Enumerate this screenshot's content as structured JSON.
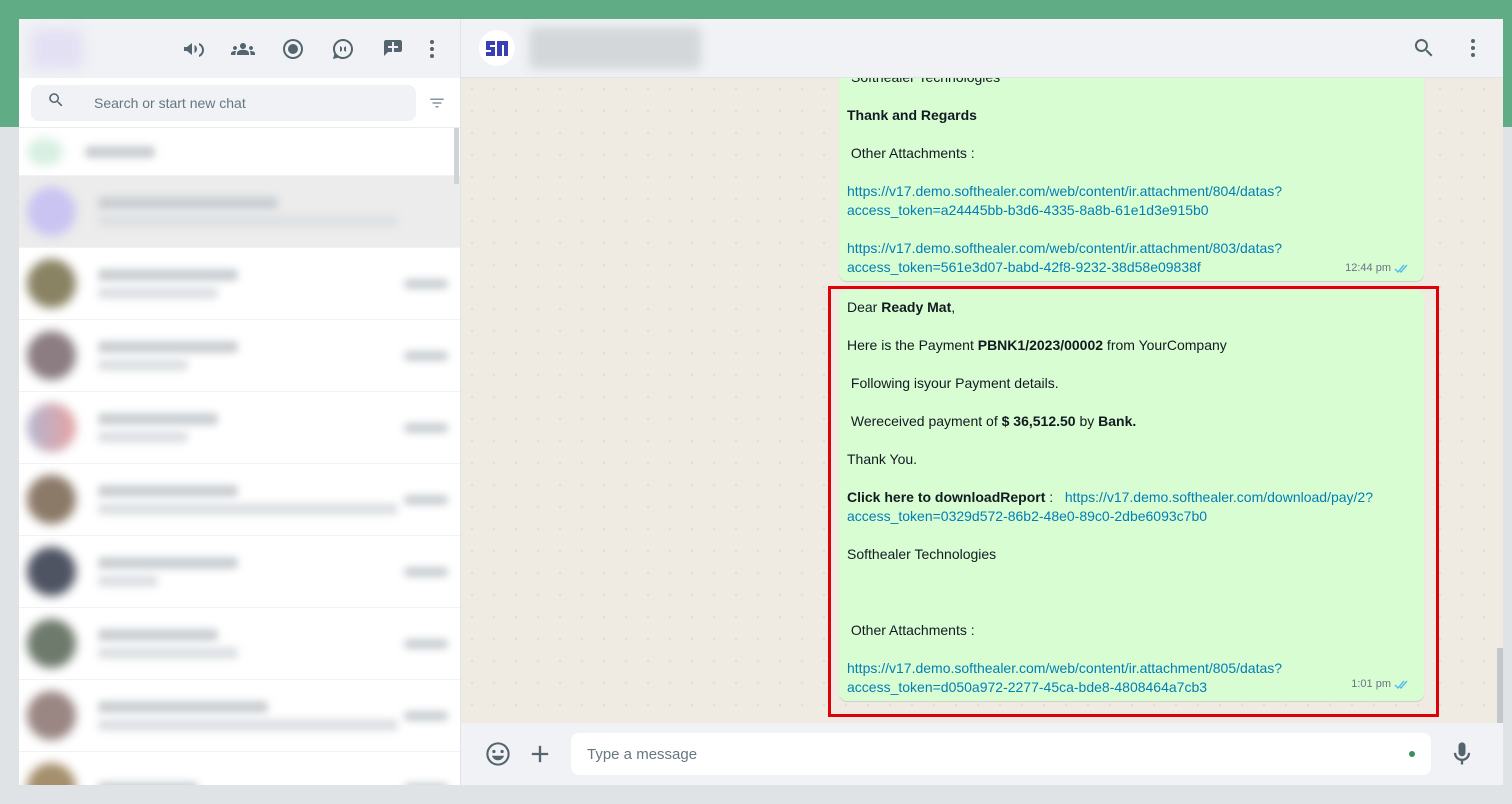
{
  "sidebar": {
    "header_icons": [
      "megaphone-icon",
      "community-icon",
      "status-icon",
      "channels-icon",
      "new-chat-icon",
      "menu-icon"
    ],
    "search": {
      "placeholder": "Search or start new chat"
    }
  },
  "conversation": {
    "message_1": {
      "company_top": "Softhealer Technologies",
      "closing": "Thank and Regards",
      "attachments_label": " Other Attachments :",
      "link_1": "https://v17.demo.softhealer.com/web/content/ir.attachment/804/datas?access_token=a24445bb-b3d6-4335-8a8b-61e1d3e915b0",
      "link_1_line1": "https://v17.demo.softhealer.com/web/content/ir.attachment/804/datas?",
      "link_1_line2": "access_token=a24445bb-b3d6-4335-8a8b-61e1d3e915b0",
      "link_2": "https://v17.demo.softhealer.com/web/content/ir.attachment/803/datas?access_token=561e3d07-babd-42f8-9232-38d58e09838f",
      "link_2_line1": "https://v17.demo.softhealer.com/web/content/ir.attachment/803/datas?",
      "link_2_line2": "access_token=561e3d07-babd-42f8-9232-38d58e09838f",
      "time": "12:44 pm"
    },
    "message_2": {
      "greeting_prefix": "Dear ",
      "customer": "Ready Mat",
      "greeting_suffix": ",",
      "payment_prefix": "Here is the Payment ",
      "payment_ref": "PBNK1/2023/00002",
      "payment_suffix": " from YourCompany",
      "details_line": " Following isyour Payment details.",
      "received_prefix": " Wereceived payment of ",
      "amount": "$ 36,512.50",
      "received_mid": " by ",
      "journal": "Bank.",
      "thanks": "Thank You.",
      "report_label": "Click here to downloadReport",
      "report_sep": " :   ",
      "report_link": "https://v17.demo.softhealer.com/download/pay/2?access_token=0329d572-86b2-48e0-89c0-2dbe6093c7b0",
      "report_link_line1": "https://v17.demo.softhealer.com/download/pay/2?",
      "report_link_line2": "access_token=0329d572-86b2-48e0-89c0-2dbe6093c7b0",
      "company": "Softhealer Technologies",
      "attachments_label": " Other Attachments :",
      "attachment_link": "https://v17.demo.softhealer.com/web/content/ir.attachment/805/datas?access_token=d050a972-2277-45ca-bde8-4808464a7cb3",
      "attachment_link_line1": "https://v17.demo.softhealer.com/web/content/ir.attachment/805/datas?",
      "attachment_link_line2": "access_token=d050a972-2277-45ca-bde8-4808464a7cb3",
      "time": "1:01 pm"
    }
  },
  "composer": {
    "placeholder": "Type a message"
  },
  "colors": {
    "accent": "#5fac85",
    "bubble": "#d9fdd3",
    "link": "#027eb5",
    "highlight": "#e0000a"
  }
}
